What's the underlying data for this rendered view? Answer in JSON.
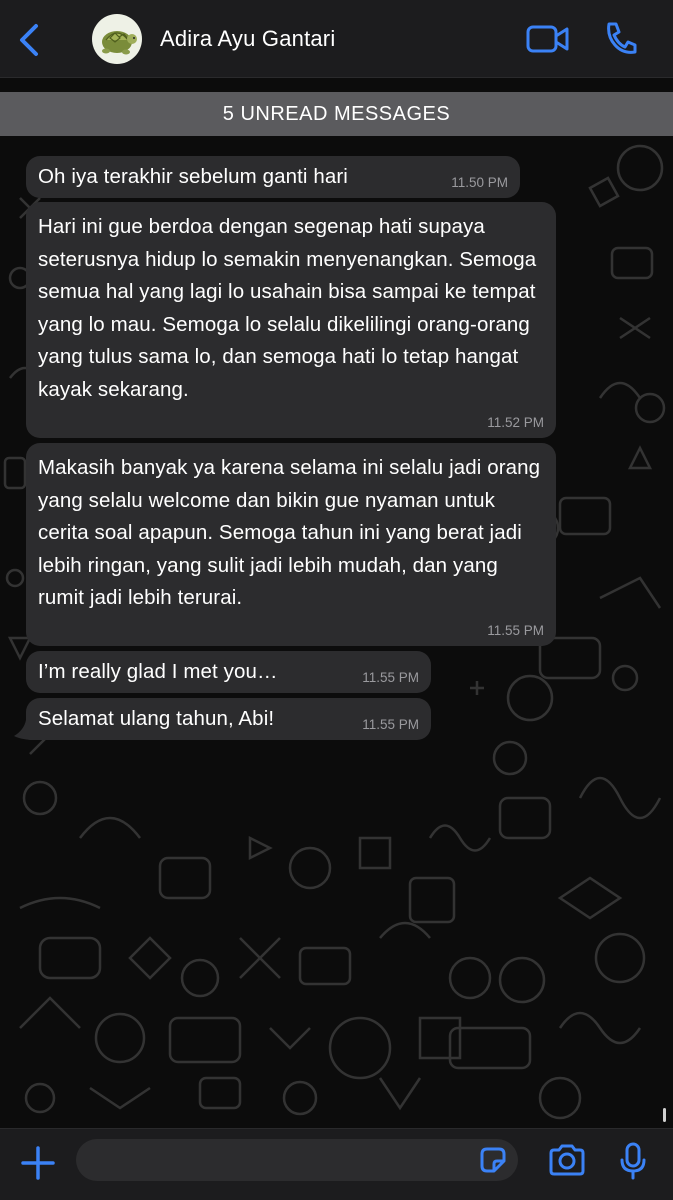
{
  "header": {
    "contact_name": "Adira Ayu Gantari",
    "back_icon": "chevron-left-icon",
    "video_icon": "video-camera-icon",
    "call_icon": "phone-icon"
  },
  "banner": {
    "unread_label": "5 UNREAD MESSAGES"
  },
  "messages": [
    {
      "text": "Oh iya terakhir sebelum ganti hari",
      "time": "11.50 PM"
    },
    {
      "text": "Hari ini gue berdoa dengan segenap hati supaya seterusnya hidup lo semakin menyenangkan. Semoga semua hal yang lagi lo usahain bisa sampai ke tempat yang lo mau. Semoga lo selalu dikelilingi orang-orang yang tulus sama lo, dan semoga hati lo tetap hangat kayak sekarang.",
      "time": "11.52 PM"
    },
    {
      "text": "Makasih banyak ya karena selama ini selalu jadi orang yang selalu welcome dan bikin gue nyaman untuk cerita soal apapun. Semoga tahun ini yang berat jadi lebih ringan, yang sulit jadi lebih mudah, dan yang rumit jadi lebih terurai.",
      "time": "11.55 PM"
    },
    {
      "text": "I’m really glad I met you…",
      "time": "11.55 PM"
    },
    {
      "text": "Selamat ulang tahun, Abi!",
      "time": "11.55 PM"
    }
  ],
  "input_bar": {
    "message_value": "",
    "plus_icon": "plus-icon",
    "sticker_icon": "sticker-icon",
    "camera_icon": "camera-icon",
    "mic_icon": "microphone-icon"
  },
  "colors": {
    "accent": "#3b82f6",
    "bubble_incoming": "#2c2c2e",
    "header_bg": "#1c1c1e",
    "unread_banner": "#5b5b5e"
  }
}
